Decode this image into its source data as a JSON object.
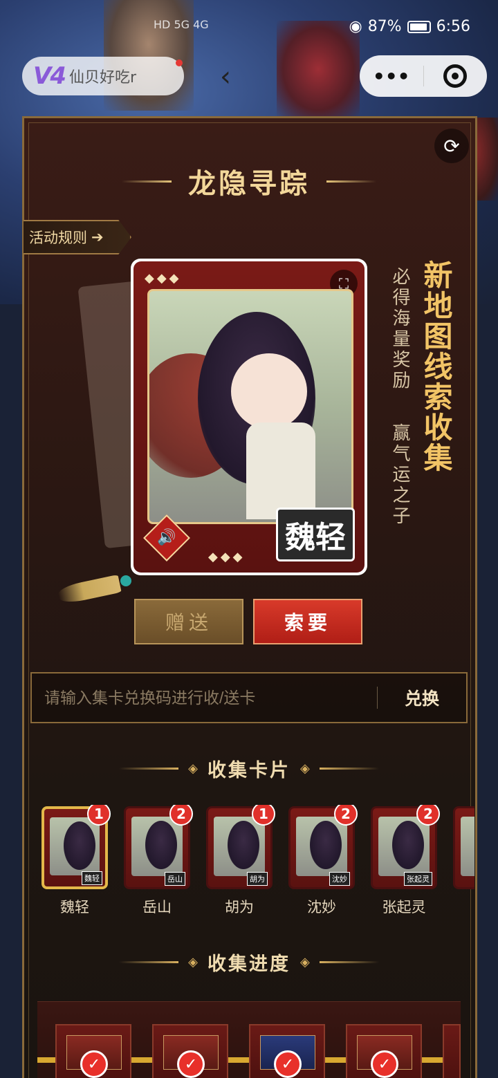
{
  "status_bar": {
    "network": "HD 5G 4G",
    "battery": "87%",
    "time": "6:56"
  },
  "mini_program": {
    "logo": "V4",
    "name": "仙贝好吃r",
    "more_label": "•••"
  },
  "activity": {
    "title": "龙隐寻踪",
    "rules_label": "活动规则",
    "slogan_left_1": "必得海量奖励",
    "slogan_left_2": "赢气运之子",
    "slogan_right": "新地图线索收集"
  },
  "featured_card": {
    "name": "魏轻",
    "diamonds": "◆◆◆"
  },
  "actions": {
    "gift_label": "赠送",
    "ask_label": "索要"
  },
  "redeem": {
    "placeholder": "请输入集卡兑换码进行收/送卡",
    "button_label": "兑换"
  },
  "collect_cards": {
    "title": "收集卡片",
    "items": [
      {
        "name": "魏轻",
        "count": "1",
        "active": true
      },
      {
        "name": "岳山",
        "count": "2",
        "active": false
      },
      {
        "name": "胡为",
        "count": "1",
        "active": false
      },
      {
        "name": "沈妙",
        "count": "2",
        "active": false
      },
      {
        "name": "张起灵",
        "count": "2",
        "active": false
      }
    ]
  },
  "progress": {
    "title": "收集进度",
    "check_mark": "✓"
  },
  "colors": {
    "accent_gold": "#f3d79a",
    "ask_red": "#d83a2a",
    "badge_red": "#e0302a",
    "panel_bg": "#2a1712"
  }
}
